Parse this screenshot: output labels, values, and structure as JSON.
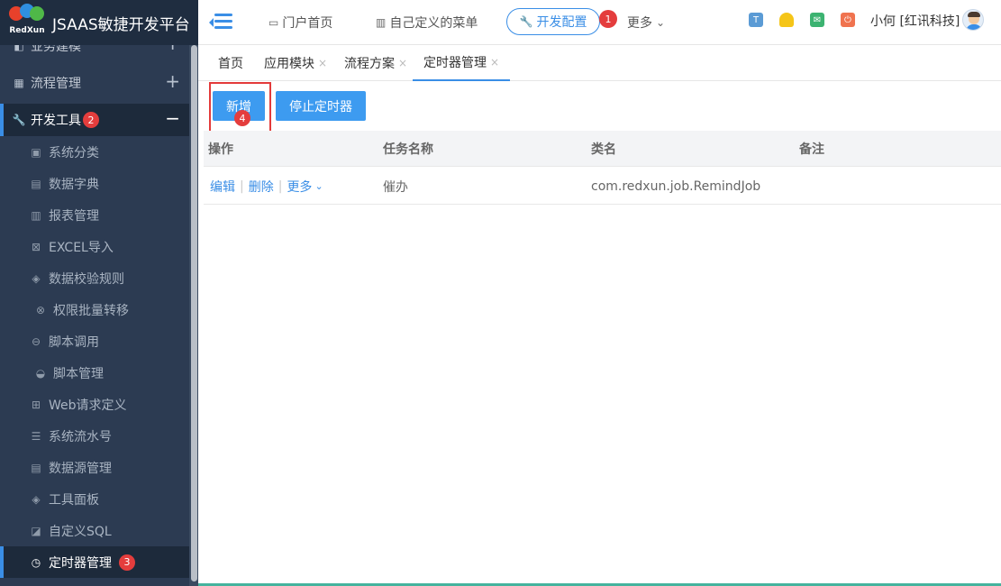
{
  "brand": {
    "logo_text": "RedXun",
    "title": "JSAAS敏捷开发平台"
  },
  "sidebar": {
    "groups": [
      {
        "label": "业务建模",
        "toggle": "+"
      },
      {
        "label": "流程管理",
        "toggle": "+"
      },
      {
        "label": "开发工具",
        "toggle": "−",
        "badge": "2"
      }
    ],
    "items": [
      {
        "label": "系统分类",
        "icon": "calendar-icon"
      },
      {
        "label": "数据字典",
        "icon": "dictionary-icon"
      },
      {
        "label": "报表管理",
        "icon": "bar-chart-icon"
      },
      {
        "label": "EXCEL导入",
        "icon": "excel-icon"
      },
      {
        "label": "数据校验规则",
        "icon": "cube-icon"
      },
      {
        "label": "权限批量转移",
        "icon": "transfer-icon"
      },
      {
        "label": "脚本调用",
        "icon": "script-icon"
      },
      {
        "label": "脚本管理",
        "icon": "script-manage-icon"
      },
      {
        "label": "Web请求定义",
        "icon": "table-icon"
      },
      {
        "label": "系统流水号",
        "icon": "list-icon"
      },
      {
        "label": "数据源管理",
        "icon": "database-icon"
      },
      {
        "label": "工具面板",
        "icon": "cube-icon"
      },
      {
        "label": "自定义SQL",
        "icon": "edit-icon"
      },
      {
        "label": "定时器管理",
        "icon": "clock-icon",
        "badge": "3"
      }
    ]
  },
  "header": {
    "nav": [
      {
        "label": "门户首页",
        "icon": "monitor-icon"
      },
      {
        "label": "自己定义的菜单",
        "icon": "building-icon"
      },
      {
        "label": "开发配置",
        "icon": "wrench-icon",
        "badge": "1"
      },
      {
        "label": "更多",
        "icon": "chevron-down-icon"
      }
    ],
    "user": "小何 [红讯科技]",
    "icon_colors": {
      "shirt": "#5b9bd5",
      "bell": "#f5c518",
      "mail": "#3cb371",
      "power": "#f0734f"
    }
  },
  "tabs": [
    {
      "label": "首页",
      "closable": false
    },
    {
      "label": "应用模块",
      "closable": true
    },
    {
      "label": "流程方案",
      "closable": true
    },
    {
      "label": "定时器管理",
      "closable": true,
      "active": true
    }
  ],
  "toolbar": {
    "add": "新增",
    "add_badge": "4",
    "stop": "停止定时器"
  },
  "table": {
    "headers": [
      "操作",
      "任务名称",
      "类名",
      "备注"
    ],
    "rows": [
      {
        "actions": [
          "编辑",
          "删除",
          "更多"
        ],
        "name": "催办",
        "class": "com.redxun.job.RemindJob",
        "remark": ""
      }
    ]
  },
  "colors": {
    "accent": "#3a8ee6",
    "sidebar": "#2c3b52",
    "badge": "#e43d3d"
  }
}
